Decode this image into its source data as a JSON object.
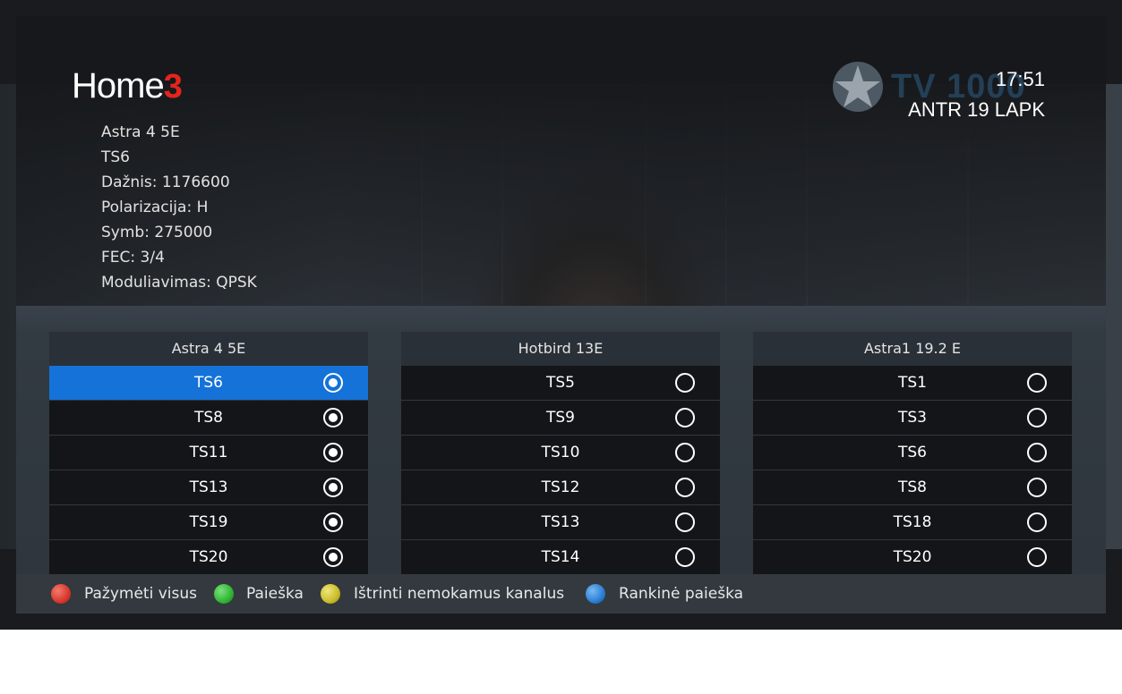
{
  "header": {
    "logo_text": "Home",
    "logo_accent": "3",
    "clock": "17:51",
    "channel_name": "ANTR 19 LAPK",
    "channel_logo_text": "TV 1000",
    "channel_logo_icon": "star-icon"
  },
  "transponder_info": [
    "Astra 4 5E",
    "TS6",
    "Dažnis: 1176600",
    "Polarizacija: H",
    "Symb: 275000",
    "FEC: 3/4",
    "Moduliavimas: QPSK"
  ],
  "columns": [
    {
      "title": "Astra 4 5E",
      "rows": [
        {
          "label": "TS6",
          "checked": true,
          "selected": true
        },
        {
          "label": "TS8",
          "checked": true,
          "selected": false
        },
        {
          "label": "TS11",
          "checked": true,
          "selected": false
        },
        {
          "label": "TS13",
          "checked": true,
          "selected": false
        },
        {
          "label": "TS19",
          "checked": true,
          "selected": false
        },
        {
          "label": "TS20",
          "checked": true,
          "selected": false
        }
      ]
    },
    {
      "title": "Hotbird 13E",
      "rows": [
        {
          "label": "TS5",
          "checked": false,
          "selected": false
        },
        {
          "label": "TS9",
          "checked": false,
          "selected": false
        },
        {
          "label": "TS10",
          "checked": false,
          "selected": false
        },
        {
          "label": "TS12",
          "checked": false,
          "selected": false
        },
        {
          "label": "TS13",
          "checked": false,
          "selected": false
        },
        {
          "label": "TS14",
          "checked": false,
          "selected": false
        }
      ]
    },
    {
      "title": "Astra1 19.2 E",
      "rows": [
        {
          "label": "TS1",
          "checked": false,
          "selected": false
        },
        {
          "label": "TS3",
          "checked": false,
          "selected": false
        },
        {
          "label": "TS6",
          "checked": false,
          "selected": false
        },
        {
          "label": "TS8",
          "checked": false,
          "selected": false
        },
        {
          "label": "TS18",
          "checked": false,
          "selected": false
        },
        {
          "label": "TS20",
          "checked": false,
          "selected": false
        }
      ]
    }
  ],
  "footer": {
    "buttons": [
      {
        "color": "#d8382c",
        "label": "Pažymėti visus"
      },
      {
        "color": "#2fb533",
        "label": "Paieška"
      },
      {
        "color": "#c9bc2a",
        "label": "Ištrinti nemokamus kanalus"
      },
      {
        "color": "#2a7fd4",
        "label": "Rankinė paieška"
      }
    ]
  },
  "colors": {
    "selection": "#1472d8",
    "logo_accent": "#e3251c"
  }
}
